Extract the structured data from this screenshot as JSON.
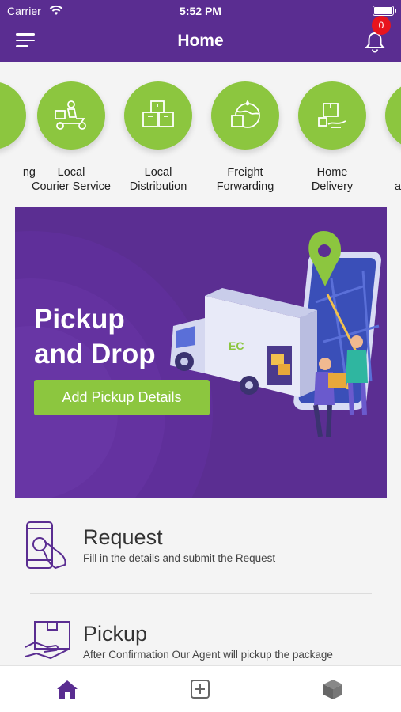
{
  "status_bar": {
    "carrier": "Carrier",
    "time": "5:52 PM"
  },
  "header": {
    "title": "Home",
    "notification_count": "0"
  },
  "services": [
    {
      "label": "ng",
      "icon": "tracking-icon"
    },
    {
      "label": "Local\nCourier Service",
      "icon": "courier-scooter-icon"
    },
    {
      "label": "Local\nDistribution",
      "icon": "boxes-icon"
    },
    {
      "label": "Freight\nForwarding",
      "icon": "globe-box-icon"
    },
    {
      "label": "Home\nDelivery",
      "icon": "home-delivery-icon"
    },
    {
      "label": "a",
      "icon": "service-icon"
    }
  ],
  "banner": {
    "title": "Pickup\nand Drop",
    "button_label": "Add Pickup Details"
  },
  "steps": [
    {
      "title": "Request",
      "description": "Fill in the details and submit the Request",
      "icon": "tap-phone-icon"
    },
    {
      "title": "Pickup",
      "description": "After Confirmation Our Agent will pickup the package",
      "icon": "hand-package-icon"
    }
  ],
  "tabbar": {
    "items": [
      "home-icon",
      "add-square-icon",
      "package-icon"
    ]
  },
  "colors": {
    "primary": "#5a2d91",
    "accent": "#8cc63f",
    "badge": "#e8141d"
  }
}
